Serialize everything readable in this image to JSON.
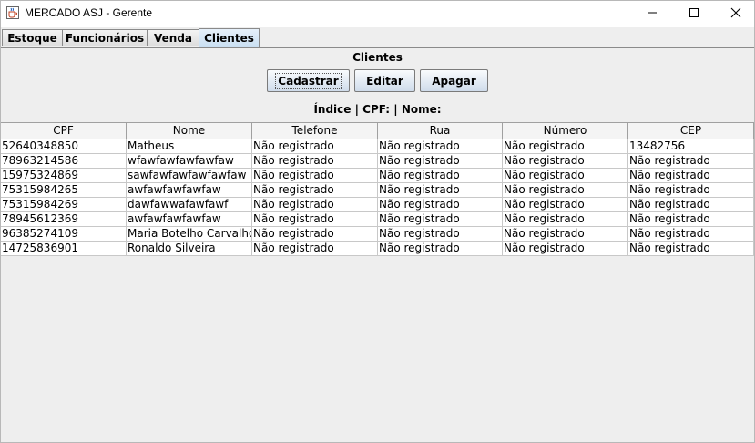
{
  "window": {
    "title": "MERCADO ASJ - Gerente"
  },
  "tabs": [
    {
      "label": "Estoque"
    },
    {
      "label": "Funcionários"
    },
    {
      "label": "Venda"
    },
    {
      "label": "Clientes",
      "selected": true
    }
  ],
  "clientes": {
    "heading": "Clientes",
    "buttons": {
      "cadastrar": "Cadastrar",
      "editar": "Editar",
      "apagar": "Apagar"
    },
    "search_label": "Índice | CPF: | Nome:",
    "table": {
      "columns": [
        "CPF",
        "Nome",
        "Telefone",
        "Rua",
        "Número",
        "CEP"
      ],
      "rows": [
        [
          "52640348850",
          "Matheus",
          "Não registrado",
          "Não registrado",
          "Não registrado",
          "13482756"
        ],
        [
          "78963214586",
          "wfawfawfawfawfaw",
          "Não registrado",
          "Não registrado",
          "Não registrado",
          "Não registrado"
        ],
        [
          "15975324869",
          "sawfawfawfawfawfaw",
          "Não registrado",
          "Não registrado",
          "Não registrado",
          "Não registrado"
        ],
        [
          "75315984265",
          "awfawfawfawfaw",
          "Não registrado",
          "Não registrado",
          "Não registrado",
          "Não registrado"
        ],
        [
          "75315984269",
          "dawfawwafawfawf",
          "Não registrado",
          "Não registrado",
          "Não registrado",
          "Não registrado"
        ],
        [
          "78945612369",
          "awfawfawfawfaw",
          "Não registrado",
          "Não registrado",
          "Não registrado",
          "Não registrado"
        ],
        [
          "96385274109",
          "Maria Botelho Carvalho",
          "Não registrado",
          "Não registrado",
          "Não registrado",
          "Não registrado"
        ],
        [
          "14725836901",
          "Ronaldo Silveira",
          "Não registrado",
          "Não registrado",
          "Não registrado",
          "Não registrado"
        ]
      ]
    }
  },
  "colors": {
    "selected_tab": "#c9dff2",
    "button_gradient_bottom": "#cfdceb",
    "background": "#eeeeee"
  }
}
